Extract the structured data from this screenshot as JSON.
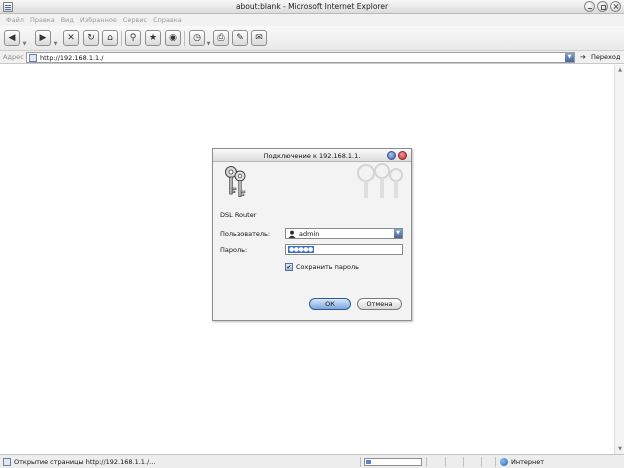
{
  "window": {
    "title": "about:blank - Microsoft Internet Explorer"
  },
  "menu": [
    "Файл",
    "Правка",
    "Вид",
    "Избранное",
    "Сервис",
    "Справка"
  ],
  "address": {
    "label": "Адрес",
    "url": "http://192.168.1.1./",
    "go_label": "Переход"
  },
  "dialog": {
    "title": "Подключение к 192.168.1.1.",
    "router": "DSL Router",
    "user_label": "Пользователь:",
    "user_value": "admin",
    "password_label": "Пароль:",
    "password_mask": "●●●●●",
    "remember_label": "Сохранить пароль",
    "remember_checked": true,
    "ok_label": "ОК",
    "cancel_label": "Отмена"
  },
  "status": {
    "text": "Открытие страницы http://192.168.1.1./...",
    "zone": "Интернет",
    "progress": 0.1
  },
  "icons": {
    "back": "back-arrow-icon",
    "forward": "forward-arrow-icon",
    "stop": "stop-icon",
    "refresh": "refresh-icon",
    "home": "home-icon",
    "search": "search-icon",
    "favorites": "favorites-icon",
    "media": "media-icon",
    "history": "history-icon",
    "print": "print-icon",
    "edit": "edit-icon",
    "discuss": "discuss-icon",
    "keys": "keys-icon"
  },
  "colors": {
    "accent": "#3d6fc1",
    "close_button": "#b92b2b",
    "help_button": "#3f63a8"
  }
}
